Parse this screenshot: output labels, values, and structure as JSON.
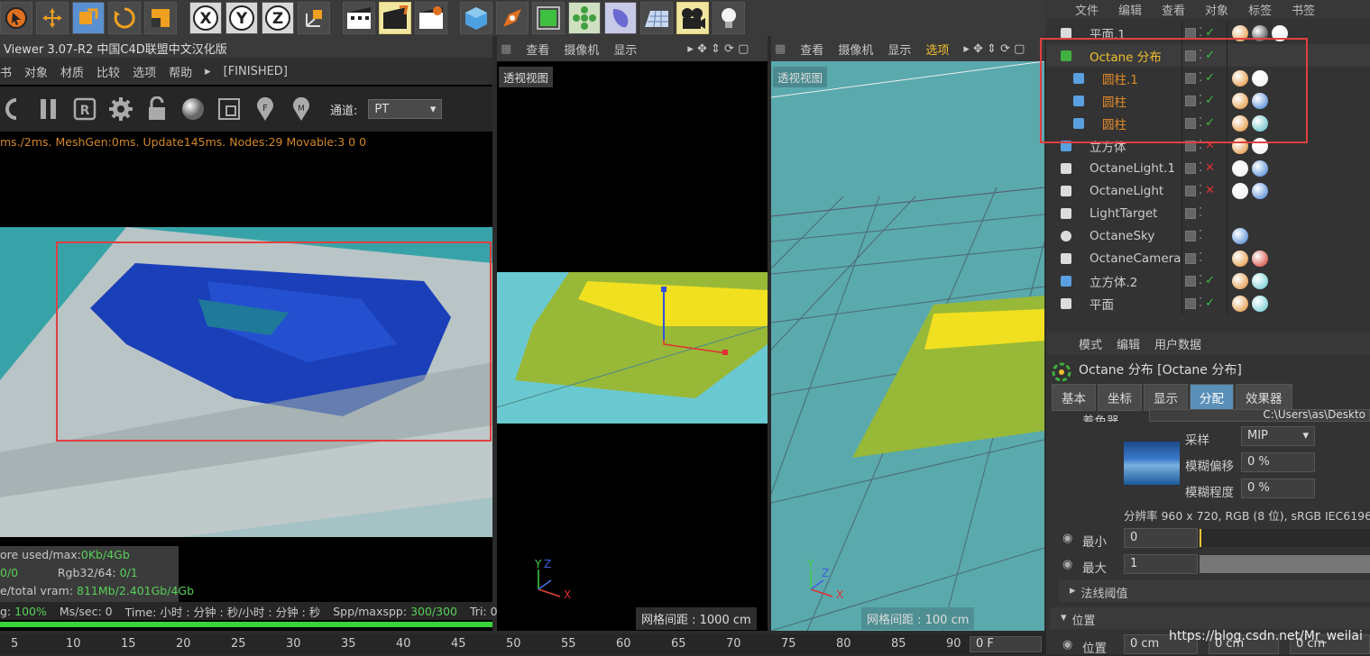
{
  "toolbar": {
    "icons": [
      "select-icon",
      "move-icon",
      "scale-icon",
      "rotate-icon",
      "scale-box-icon",
      "x-axis-icon",
      "y-axis-icon",
      "z-axis-icon",
      "world-coord-icon",
      "render-view-icon",
      "render-pv-icon",
      "render-settings-icon",
      "cube-icon",
      "pen-icon",
      "subdivision-icon",
      "array-icon",
      "deformer-icon",
      "floor-icon",
      "camera-icon",
      "light-icon"
    ],
    "axis_x": "X",
    "axis_y": "Y",
    "axis_z": "Z"
  },
  "octane_viewer": {
    "title": "Viewer 3.07-R2 中国C4D联盟中文汉化版",
    "menu": [
      "书",
      "对象",
      "材质",
      "比较",
      "选项",
      "帮助",
      "▸",
      "[FINISHED]"
    ],
    "channel_label": "通道:",
    "channel_value": "PT",
    "status": "ms./2ms. MeshGen:0ms. Update145ms. Nodes:29 Movable:3  0 0",
    "stats": {
      "line1_label": "ore used/max:",
      "line1_value": "0Kb/4Gb",
      "line2_left": "0/0",
      "line2_label": "Rgb32/64: ",
      "line2_value": "0/1",
      "line3_label": "e/total vram: ",
      "line3_value": "811Mb/2.401Gb/4Gb"
    },
    "bottom": {
      "progress_label": "g: ",
      "progress_text": "100%",
      "mssec": "Ms/sec: 0",
      "time": "Time: 小时 : 分钟 : 秒/小时 : 分钟 : 秒",
      "spp_label": "Spp/maxspp: ",
      "spp_value": "300/300",
      "tri": "Tri: 0/1k"
    },
    "progress": 1.0
  },
  "viewport_mid": {
    "menu": [
      "查看",
      "摄像机",
      "显示"
    ],
    "label": "透视视图",
    "grid": "网格间距 : 1000 cm",
    "axes": {
      "y": "Y",
      "z": "Z",
      "x": "X"
    }
  },
  "viewport_right": {
    "menu": [
      "查看",
      "摄像机",
      "显示",
      "选项"
    ],
    "label": "透视视图",
    "grid": "网格间距 : 100 cm",
    "axes": {
      "y": "Y",
      "z": "Z",
      "x": "X"
    }
  },
  "object_manager": {
    "menu": [
      "文件",
      "编辑",
      "查看",
      "对象",
      "标签",
      "书签"
    ],
    "rows": [
      {
        "name": "平面.1",
        "icon": "plane-icon",
        "color": "#cccccc"
      },
      {
        "name": "Octane 分布",
        "icon": "distribution-icon",
        "color": "#f0c030"
      },
      {
        "name": "圆柱.1",
        "icon": "cylinder-icon",
        "color": "#e08a2a"
      },
      {
        "name": "圆柱",
        "icon": "cylinder-icon",
        "color": "#e08a2a"
      },
      {
        "name": "圆柱",
        "icon": "cylinder-icon",
        "color": "#e08a2a"
      },
      {
        "name": "立方体",
        "icon": "cube-icon",
        "color": "#cccccc"
      },
      {
        "name": "OctaneLight.1",
        "icon": "light-icon",
        "color": "#cccccc"
      },
      {
        "name": "OctaneLight",
        "icon": "light-icon",
        "color": "#cccccc"
      },
      {
        "name": "LightTarget",
        "icon": "target-icon",
        "color": "#cccccc"
      },
      {
        "name": "OctaneSky",
        "icon": "sky-icon",
        "color": "#cccccc"
      },
      {
        "name": "OctaneCamera",
        "icon": "camera-icon",
        "color": "#cccccc"
      },
      {
        "name": "立方体.2",
        "icon": "cube-icon",
        "color": "#cccccc"
      },
      {
        "name": "平面",
        "icon": "plane-icon",
        "color": "#cccccc"
      }
    ]
  },
  "attributes": {
    "menu": [
      "模式",
      "编辑",
      "用户数据"
    ],
    "title": "Octane 分布 [Octane 分布]",
    "tabs": [
      "基本",
      "坐标",
      "显示",
      "分配",
      "效果器"
    ],
    "active_tab": "分配",
    "shader_label": "着色器",
    "path": "C:\\Users\\as\\Deskto",
    "sampling_label": "采样",
    "sampling_value": "MIP",
    "blur_offset_label": "模糊偏移",
    "blur_offset_value": "0 %",
    "blur_scale_label": "模糊程度",
    "blur_scale_value": "0 %",
    "resolution": "分辨率 960 x 720, RGB (8 位), sRGB IEC6196",
    "min_label": "最小",
    "min_value": "0",
    "max_label": "最大",
    "max_value": "1",
    "normal_label": "法线阈值",
    "position_label": "位置",
    "pos_x_label": "位置",
    "pos_x_value": "0 cm",
    "pos_y_value": "0 cm",
    "pos_z_value": "0 cm"
  },
  "timeline": {
    "ticks": [
      "5",
      "10",
      "15",
      "20",
      "25",
      "30",
      "35",
      "40",
      "45",
      "50",
      "55",
      "60",
      "65",
      "70",
      "75",
      "80",
      "85",
      "90"
    ],
    "frame": "0 F"
  },
  "watermark": "https://blog.csdn.net/Mr_weilai",
  "colors": {
    "accent": "#5a8fb8",
    "highlight": "#e04040",
    "orange": "#e08a2a",
    "green": "#39d439"
  }
}
